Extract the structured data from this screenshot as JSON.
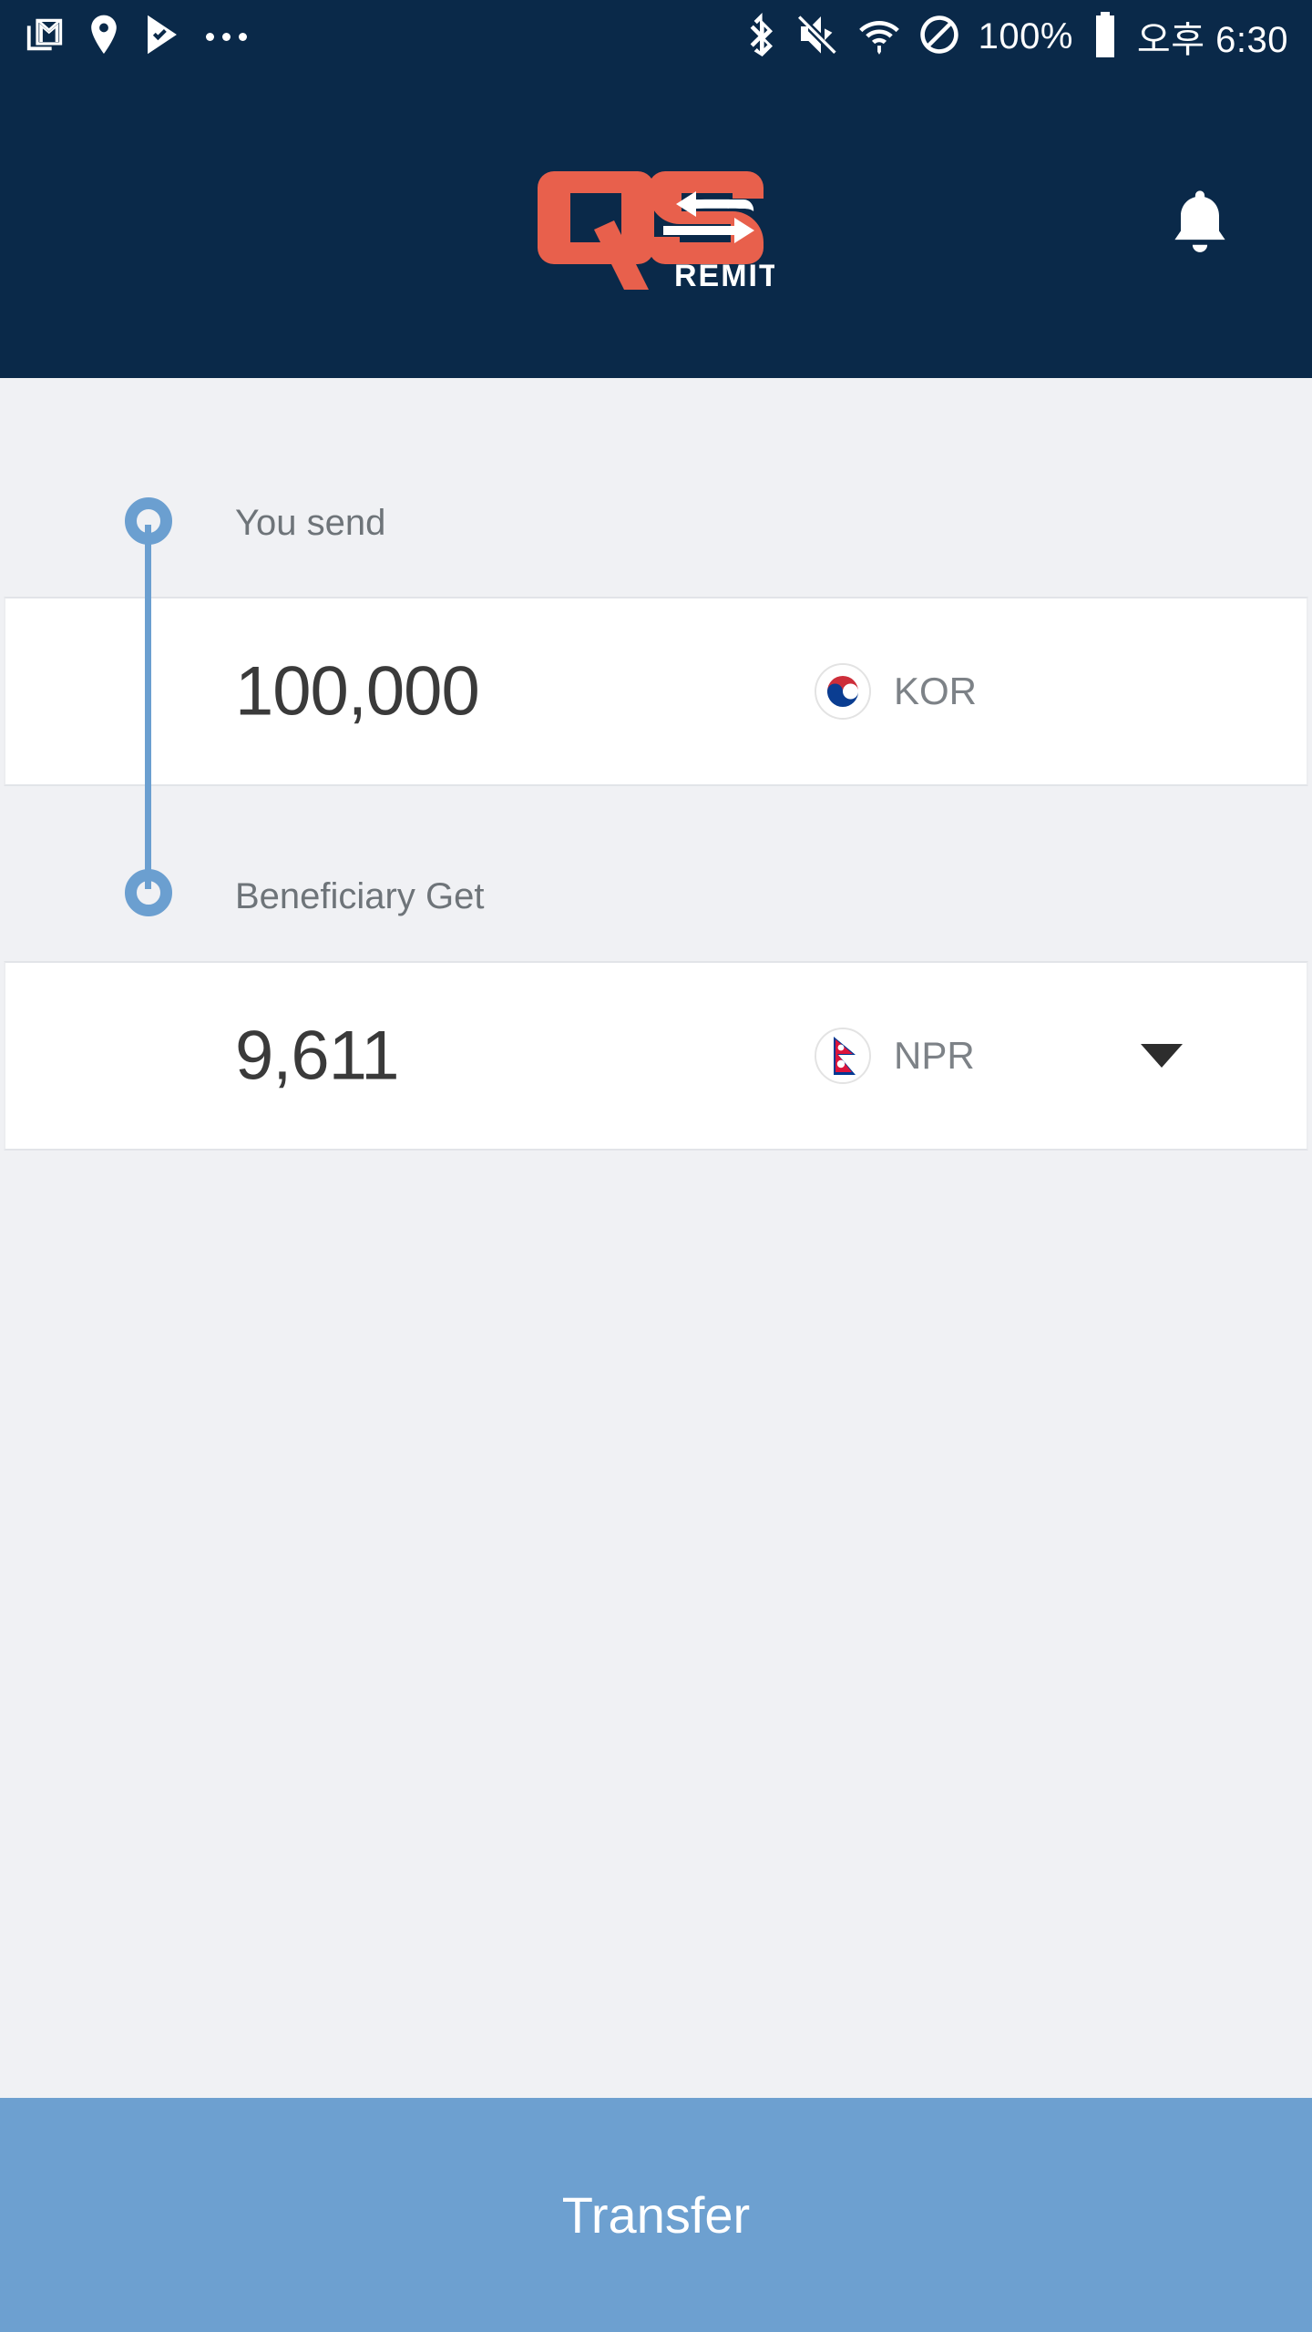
{
  "status_bar": {
    "left_icons": [
      "gmail-icon",
      "location-pin-icon",
      "play-check-icon",
      "more-dots-icon"
    ],
    "right_icons": [
      "bluetooth-icon",
      "mute-icon",
      "wifi-icon",
      "do-not-disturb-icon"
    ],
    "battery_percent": "100%",
    "battery_icon": "battery-full-icon",
    "time": "오후 6:30"
  },
  "header": {
    "logo_text": "QS",
    "logo_subtext": "REMIT",
    "logo_color": "#E8604C",
    "background_color": "#0A2949",
    "notification_icon": "bell-icon"
  },
  "form": {
    "send": {
      "label": "You send",
      "amount": "100,000",
      "currency_code": "KOR",
      "flag_icon": "south-korea-flag-icon"
    },
    "receive": {
      "label": "Beneficiary Get",
      "amount": "9,611",
      "currency_code": "NPR",
      "flag_icon": "nepal-flag-icon",
      "dropdown_icon": "chevron-down-icon"
    },
    "accent_color": "#6B9FD0"
  },
  "footer": {
    "transfer_label": "Transfer",
    "transfer_color": "#6DA0D0"
  }
}
